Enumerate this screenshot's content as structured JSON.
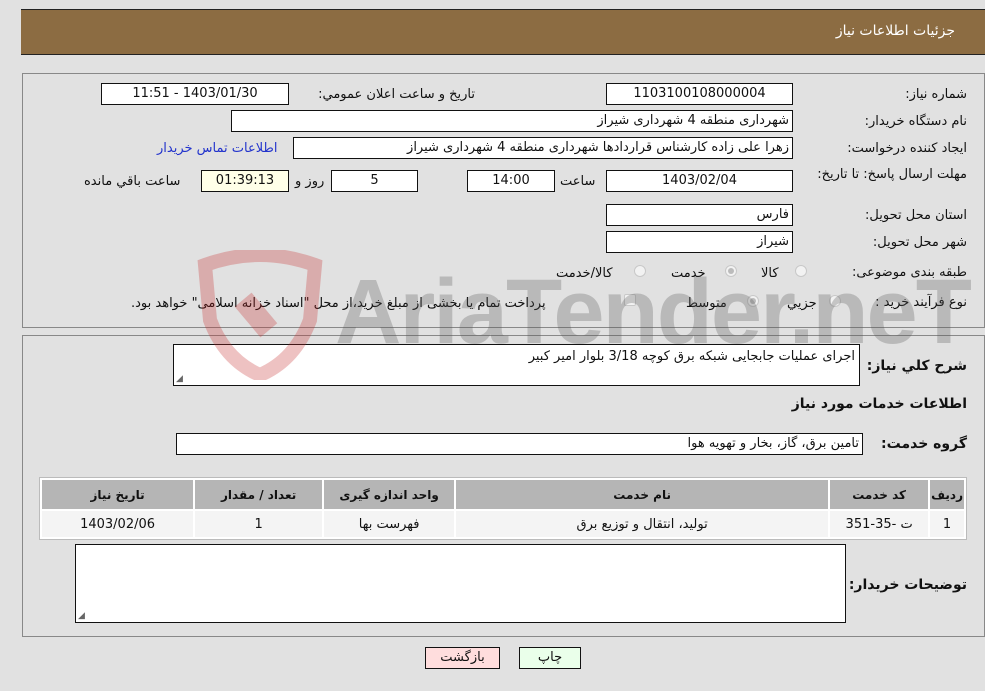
{
  "header": {
    "title": "جزئیات اطلاعات نیاز"
  },
  "form": {
    "need_number": {
      "label": "شماره نیاز:",
      "value": "1103100108000004"
    },
    "announce_datetime": {
      "label": "تاریخ و ساعت اعلان عمومي:",
      "value": "1403/01/30 - 11:51"
    },
    "buyer_org": {
      "label": "نام دستگاه خریدار:",
      "value": "شهرداری منطقه 4 شهرداری شیراز"
    },
    "requester": {
      "label": "ایجاد کننده درخواست:",
      "value": "زهرا علی زاده کارشناس قراردادها شهرداری منطقه 4 شهرداری شیراز"
    },
    "buyer_contact_link": "اطلاعات تماس خریدار",
    "deadline": {
      "label": "مهلت ارسال پاسخ: تا تاریخ:",
      "date": "1403/02/04",
      "time_label": "ساعت",
      "time": "14:00",
      "days": "5",
      "days_suffix": "روز و",
      "remaining": "01:39:13",
      "remaining_suffix": "ساعت باقي مانده"
    },
    "province": {
      "label": "استان محل تحویل:",
      "value": "فارس"
    },
    "city": {
      "label": "شهر محل تحویل:",
      "value": "شیراز"
    },
    "category": {
      "label": "طبقه بندی موضوعی:",
      "options": [
        "کالا",
        "خدمت",
        "کالا/خدمت"
      ],
      "selected": "خدمت"
    },
    "process": {
      "label": "نوع فرآیند خرید :",
      "options": [
        "جزیي",
        "متوسط"
      ],
      "selected": "متوسط",
      "treasury_note": "پرداخت تمام یا بخشی از مبلغ خرید،از محل \"اسناد خزانه اسلامی\" خواهد بود.",
      "treasury_checked": false
    }
  },
  "description": {
    "label": "شرح کلي نیاز:",
    "value": "اجرای عملیات جابجایی شبکه برق کوچه 3/18 بلوار امیر کبیر"
  },
  "services_section": {
    "title": "اطلاعات خدمات مورد نیاز",
    "group_label": "گروه خدمت:",
    "group_value": "تامین برق، گاز، بخار و تهویه هوا",
    "table": {
      "headers": [
        "ردیف",
        "کد خدمت",
        "نام خدمت",
        "واحد اندازه گیری",
        "تعداد / مقدار",
        "تاریخ نیاز"
      ],
      "rows": [
        [
          "1",
          "ت -35-351",
          "تولید، انتقال و توزیع برق",
          "فهرست بها",
          "1",
          "1403/02/06"
        ]
      ]
    }
  },
  "buyer_notes": {
    "label": "توضیحات خریدار:",
    "value": ""
  },
  "buttons": {
    "print": "چاپ",
    "back": "بازگشت"
  },
  "watermark": "AriaTender.neT"
}
